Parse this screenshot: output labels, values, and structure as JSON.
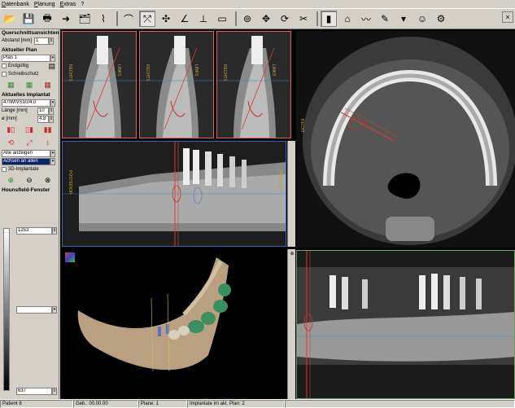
{
  "menu": [
    "Datenbank",
    "Planung",
    "Extras",
    "?"
  ],
  "toolbar_icons": [
    "open-icon",
    "save-icon",
    "print-icon",
    "arrow-icon",
    "case-icon",
    "tooth-icon",
    "sep",
    "panorama-icon",
    "direction-icon",
    "implant-icon",
    "angle-icon",
    "measure-icon",
    "ruler-icon",
    "sep",
    "camera-icon",
    "move-icon",
    "rotate-icon",
    "cut-icon",
    "sep",
    "select-icon",
    "abutment-icon",
    "nerve-icon",
    "pencil-icon",
    "dropdown-icon",
    "head-icon",
    "settings-icon"
  ],
  "close_label": "×",
  "left": {
    "section1": "Querschnittsansichten",
    "abstand_label": "Abstand [mm]",
    "abstand_value": "1",
    "section2": "Aktueller Plan",
    "plan_value": "Plan 1",
    "endgueltig": "Endgültig",
    "schreibschutz": "Schreibschutz",
    "section3": "Aktuelles Implantat",
    "implant_value": "47/WIVS10/4.0",
    "laenge_label": "Länge [mm]",
    "laenge_value": "10",
    "durchmesser_label": "ø [mm]",
    "durchmesser_value": "4.8",
    "alle_anzeigen": "Alle anzeigen",
    "achsen_an_allen": "Achsen an allen",
    "implantate_3d": "3D-Implantate",
    "section4": "Hounsfield-Fenster",
    "hf_top": "1253",
    "hf_bottom": "637"
  },
  "views": {
    "cross_labels": [
      "LINKS",
      "RECHTS"
    ],
    "axial_label": "RECHT",
    "pano_left": "POSTERIOR",
    "pano_right": "ANTERIOR"
  },
  "status": {
    "patient": "Patient 8",
    "geb": "Geb.: 00.00.00",
    "plane": "Plane: 1",
    "implantate": "Implantate im akt. Plan: 2"
  },
  "colors": {
    "cross_border": "#e06060",
    "pano_border": "#4060c0",
    "reslice_border": "#60a060",
    "implant_line": "#d04030"
  }
}
